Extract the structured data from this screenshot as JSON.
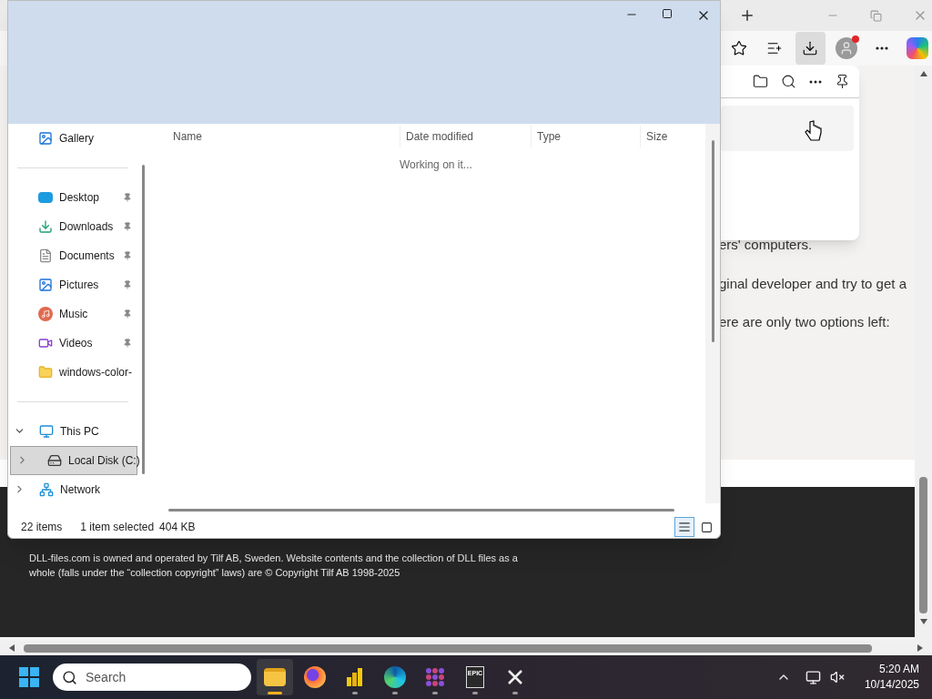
{
  "browser": {
    "toolbar": [
      {
        "kind": "star",
        "selected": false
      },
      {
        "kind": "favorites",
        "selected": false
      },
      {
        "kind": "downloads",
        "selected": true
      },
      {
        "kind": "profile",
        "selected": false
      },
      {
        "kind": "more",
        "selected": false
      },
      {
        "kind": "copilot",
        "selected": false
      }
    ],
    "downloads_panel": {
      "actions": [
        {
          "kind": "folder"
        },
        {
          "kind": "search"
        },
        {
          "kind": "more"
        },
        {
          "kind": "pin"
        }
      ]
    },
    "page": {
      "lines": [
        "ers' computers.",
        "ginal developer and try to get a",
        "ere are only two options left:"
      ],
      "footer_text": "DLL-files.com is owned and operated by Tilf AB, Sweden. Website contents and the collection of DLL files as a whole (falls under the “collection copyright” laws) are © Copyright Tilf AB 1998-2025"
    }
  },
  "explorer": {
    "sidebar": {
      "groups": [
        [
          {
            "label": "Gallery",
            "kind": "gallery",
            "pinned": false,
            "selected": false
          }
        ],
        [
          {
            "label": "Desktop",
            "kind": "desktop",
            "pinned": true,
            "selected": false
          },
          {
            "label": "Downloads",
            "kind": "downloads",
            "pinned": true,
            "selected": false
          },
          {
            "label": "Documents",
            "kind": "documents",
            "pinned": true,
            "selected": false
          },
          {
            "label": "Pictures",
            "kind": "pictures",
            "pinned": true,
            "selected": false
          },
          {
            "label": "Music",
            "kind": "music",
            "pinned": true,
            "selected": false
          },
          {
            "label": "Videos",
            "kind": "videos",
            "pinned": true,
            "selected": false
          },
          {
            "label": "windows-color-",
            "kind": "folder",
            "pinned": false,
            "selected": false
          }
        ],
        [
          {
            "label": "This PC",
            "kind": "pc",
            "expanded": true,
            "selected": false,
            "children": [
              {
                "label": "Local Disk (C:)",
                "kind": "drive",
                "expanded": false,
                "selected": true
              }
            ]
          },
          {
            "label": "Network",
            "kind": "network",
            "expanded": false,
            "selected": false
          }
        ]
      ]
    },
    "columns": [
      "Name",
      "Date modified",
      "Type",
      "Size"
    ],
    "message": "Working on it...",
    "status_bar": {
      "count": "22 items",
      "selection": "1 item selected",
      "size": "404 KB"
    },
    "views": [
      {
        "kind": "details",
        "selected": true
      },
      {
        "kind": "tiles",
        "selected": false
      }
    ]
  },
  "taskbar": {
    "search": {
      "placeholder": "Search"
    },
    "apps": [
      {
        "kind": "explorer",
        "active": true,
        "running": true
      },
      {
        "kind": "firefox",
        "active": false,
        "running": false
      },
      {
        "kind": "powerbi",
        "active": false,
        "running": true
      },
      {
        "kind": "edge",
        "active": false,
        "running": true
      },
      {
        "kind": "dots",
        "active": false,
        "running": true
      },
      {
        "kind": "epic",
        "label": "EPIC",
        "active": false,
        "running": true
      },
      {
        "kind": "x",
        "active": false,
        "running": true
      }
    ],
    "clock": {
      "time": "5:20 AM",
      "date": "10/14/2025"
    }
  }
}
